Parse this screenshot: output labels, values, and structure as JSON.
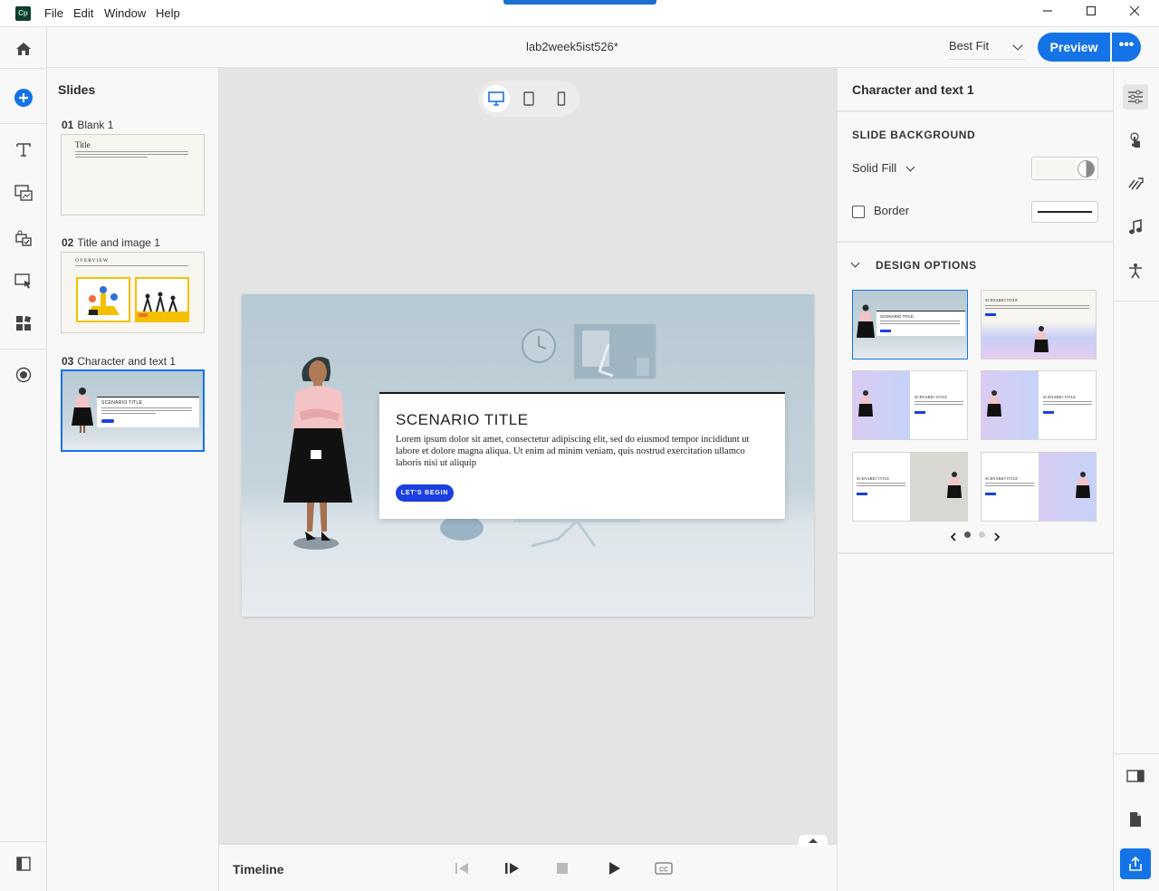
{
  "menubar": {
    "app_logo": "Cp",
    "items": [
      "File",
      "Edit",
      "Window",
      "Help"
    ],
    "window_controls": {
      "minimize": "—",
      "maximize": "☐",
      "close": "✕"
    }
  },
  "header": {
    "doc_title": "lab2week5ist526*",
    "zoom": "Best Fit",
    "preview_label": "Preview",
    "more_label": "•••"
  },
  "slides_panel": {
    "heading": "Slides",
    "slides": [
      {
        "num": "01",
        "name": "Blank 1",
        "thumb_title": "Title"
      },
      {
        "num": "02",
        "name": "Title and image 1",
        "thumb_title": "OVERVIEW"
      },
      {
        "num": "03",
        "name": "Character and text 1",
        "thumb_title": "SCENARIO TITLE"
      }
    ]
  },
  "canvas": {
    "scenario_title": "SCENARIO TITLE",
    "scenario_body": "Lorem ipsum dolor sit amet, consectetur adipiscing elit, sed do eiusmod tempor incididunt ut labore et dolore magna aliqua. Ut enim ad minim veniam, quis nostrud exercitation ullamco laboris nisi ut aliquip",
    "button_label": "LET'S BEGIN"
  },
  "timeline": {
    "label": "Timeline"
  },
  "properties": {
    "title": "Character and text 1",
    "slide_background_heading": "SLIDE BACKGROUND",
    "fill_type": "Solid Fill",
    "fill_color": "#f7f5ef",
    "border_label": "Border",
    "border_checked": false,
    "design_options_heading": "DESIGN OPTIONS",
    "design_thumb_title": "SCENARIO TITLE",
    "pager_active": 1,
    "pager_count": 2
  },
  "colors": {
    "accent": "#1473e6",
    "slide_button": "#1b3fe0"
  }
}
